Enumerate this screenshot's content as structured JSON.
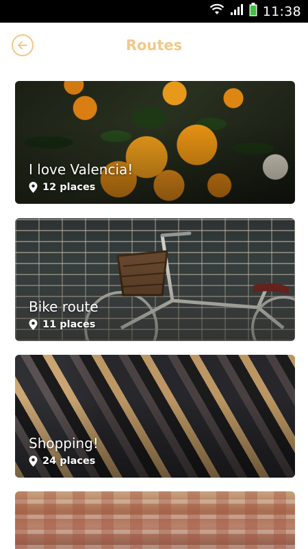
{
  "status_bar": {
    "time": "11:38",
    "icons": [
      "wifi-icon",
      "signal-icon",
      "battery-icon"
    ],
    "battery_color": "#3cc13c"
  },
  "header": {
    "title": "Routes",
    "back_icon": "arrow-left-icon",
    "accent_color": "#f1c889"
  },
  "routes": [
    {
      "title": "I love Valencia!",
      "places": "12 places",
      "image": "oranges"
    },
    {
      "title": "Bike route",
      "places": "11 places",
      "image": "bicycle-brick-wall"
    },
    {
      "title": "Shopping!",
      "places": "24 places",
      "image": "clothing-rack"
    },
    {
      "title": "",
      "places": "",
      "image": "city-rooftops"
    }
  ]
}
